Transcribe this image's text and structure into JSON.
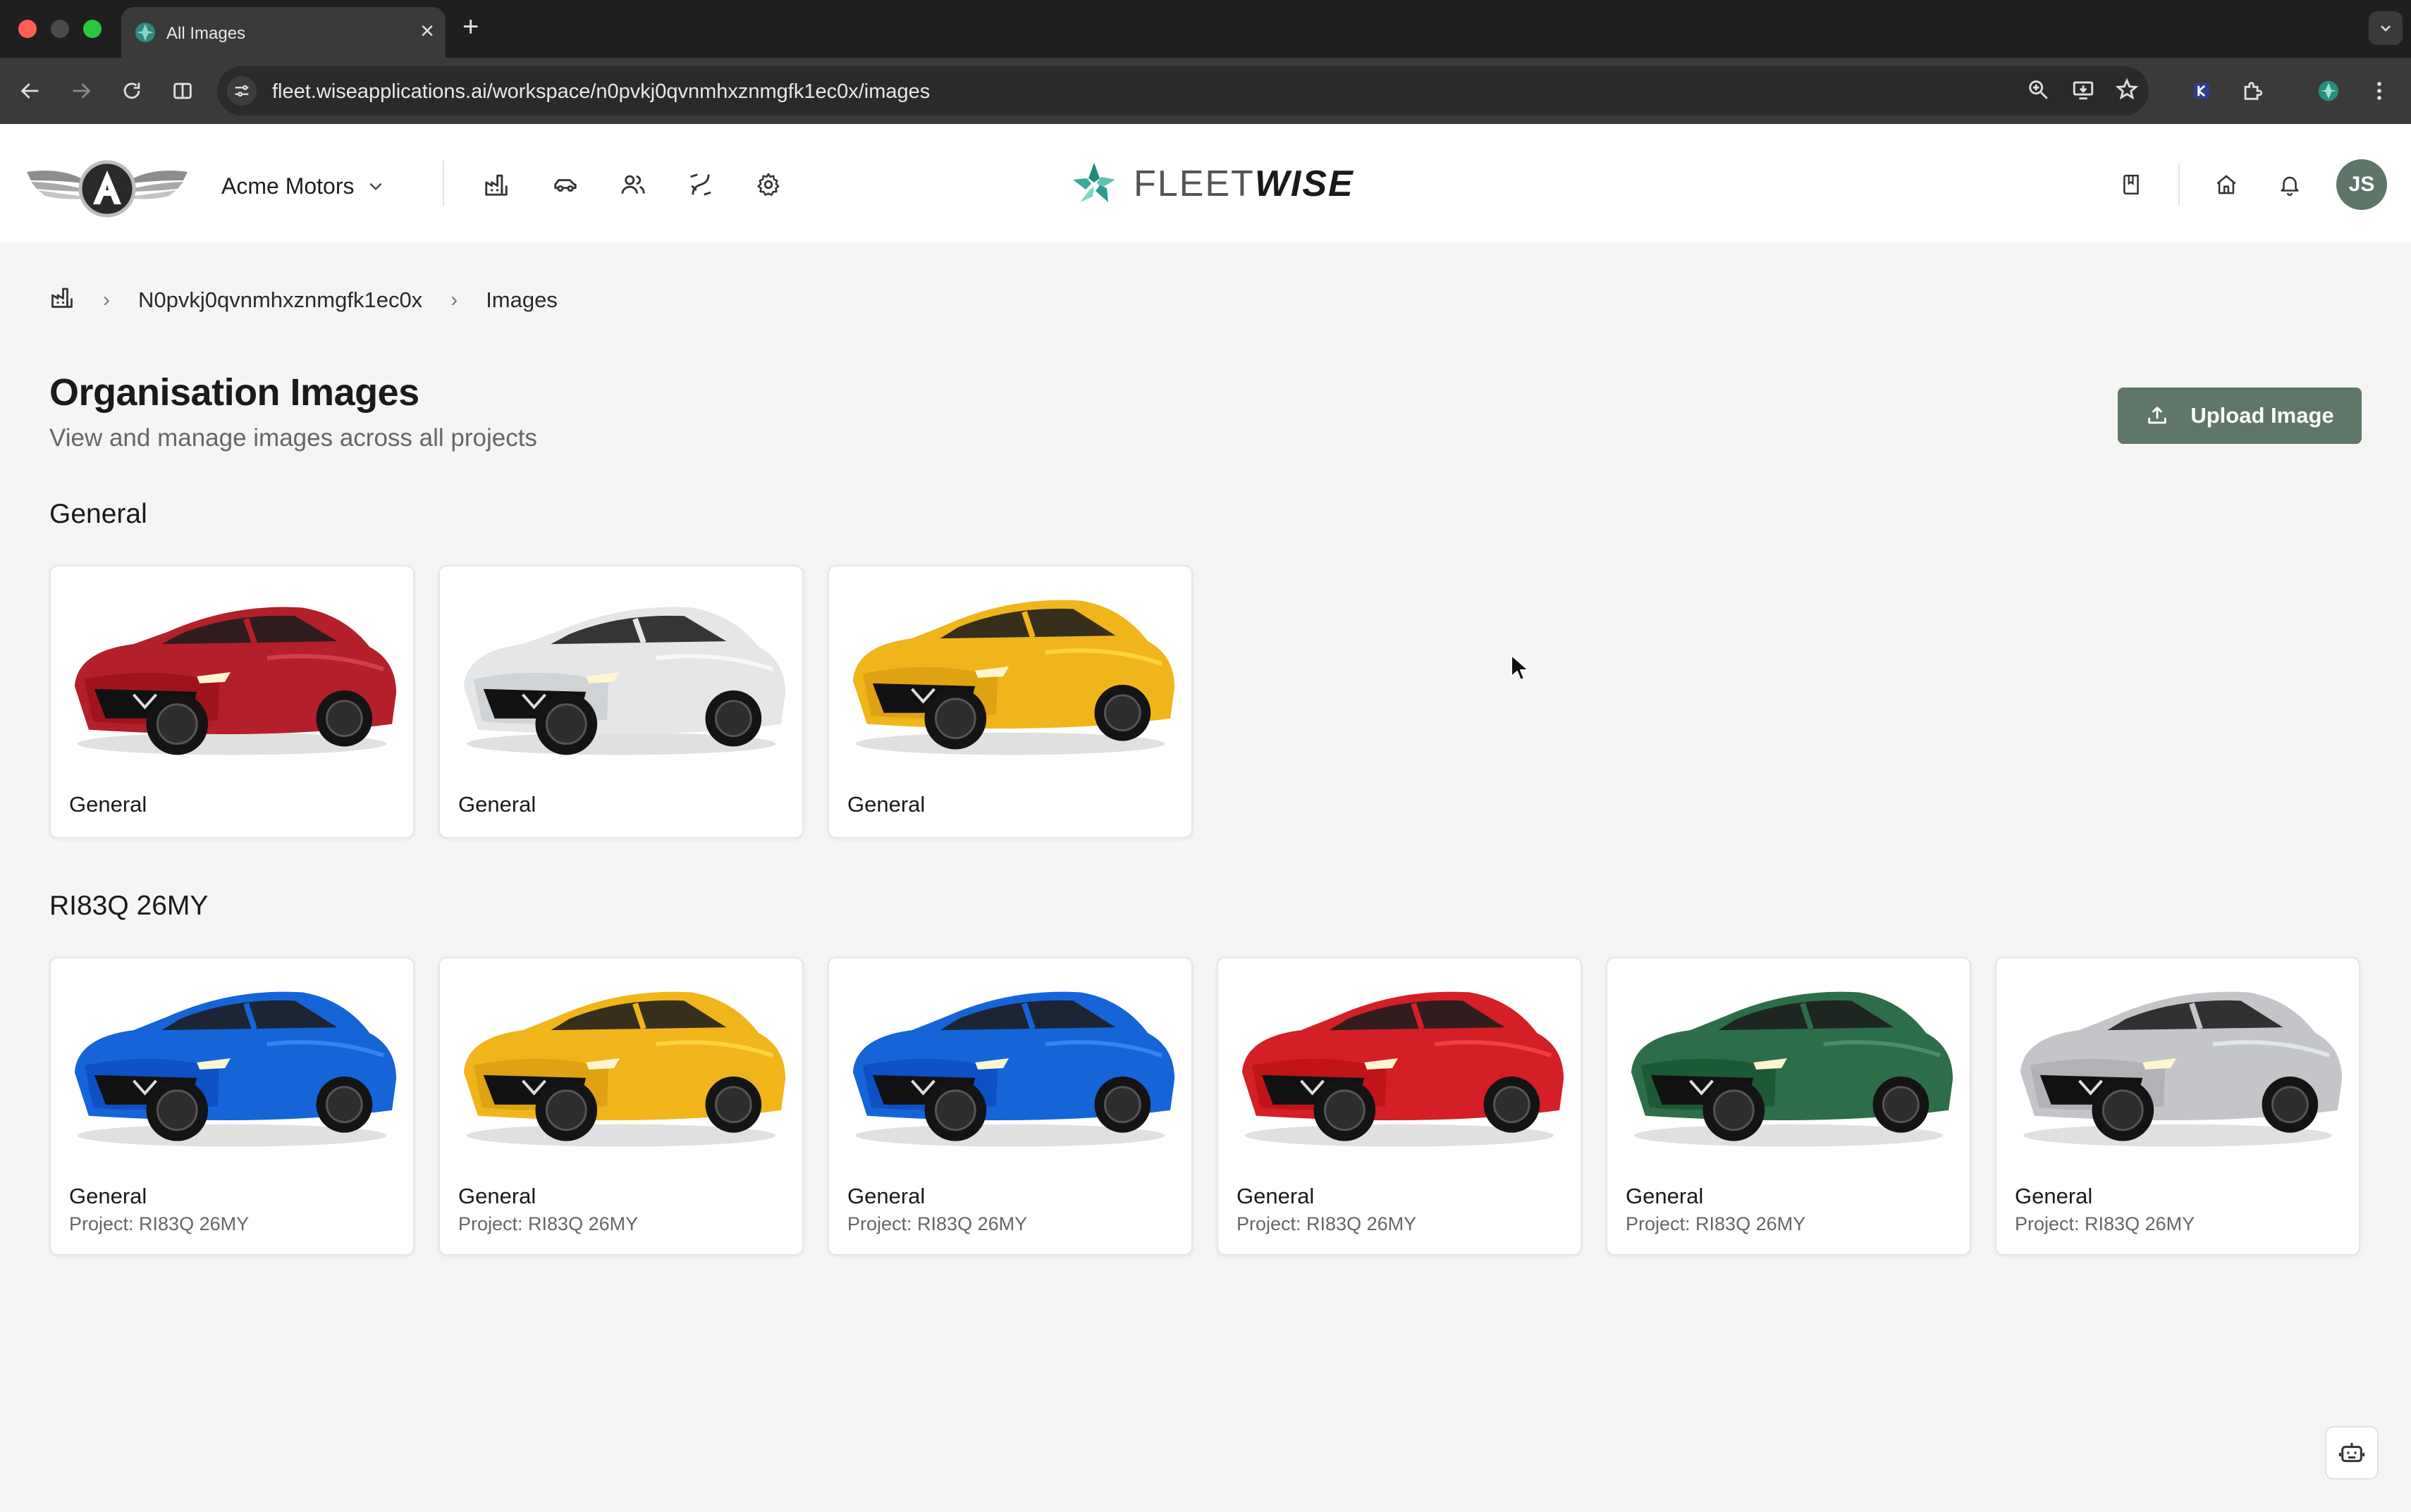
{
  "browser": {
    "tab_title": "All Images",
    "close_glyph": "×",
    "new_tab_glyph": "+",
    "url": "fleet.wiseapplications.ai/workspace/n0pvkj0qvnmhxznmgfk1ec0x/images"
  },
  "header": {
    "org_name": "Acme Motors",
    "logo_thin": "FLEET",
    "logo_bold": "WISE",
    "avatar_initials": "JS"
  },
  "breadcrumb": {
    "workspace": "N0pvkj0qvnmhxznmgfk1ec0x",
    "current": "Images"
  },
  "page": {
    "title": "Organisation Images",
    "subtitle": "View and manage images across all projects",
    "upload_label": "Upload Image"
  },
  "sections": [
    {
      "title": "General",
      "cards": [
        {
          "label": "General",
          "color": "#b3202a",
          "shape": "sedan"
        },
        {
          "label": "General",
          "color": "#e4e6e8",
          "shape": "sedan"
        },
        {
          "label": "General",
          "color": "#f1b51c",
          "shape": "suv"
        }
      ]
    },
    {
      "title": "RI83Q 26MY",
      "cards": [
        {
          "label": "General",
          "sub": "Project: RI83Q 26MY",
          "color": "#1565d8",
          "shape": "suv"
        },
        {
          "label": "General",
          "sub": "Project: RI83Q 26MY",
          "color": "#f1b51c",
          "shape": "suv"
        },
        {
          "label": "General",
          "sub": "Project: RI83Q 26MY",
          "color": "#1565d8",
          "shape": "suv"
        },
        {
          "label": "General",
          "sub": "Project: RI83Q 26MY",
          "color": "#d41f26",
          "shape": "suv"
        },
        {
          "label": "General",
          "sub": "Project: RI83Q 26MY",
          "color": "#2c6e49",
          "shape": "suv"
        },
        {
          "label": "General",
          "sub": "Project: RI83Q 26MY",
          "color": "#c3c5c8",
          "shape": "suv"
        }
      ]
    }
  ]
}
